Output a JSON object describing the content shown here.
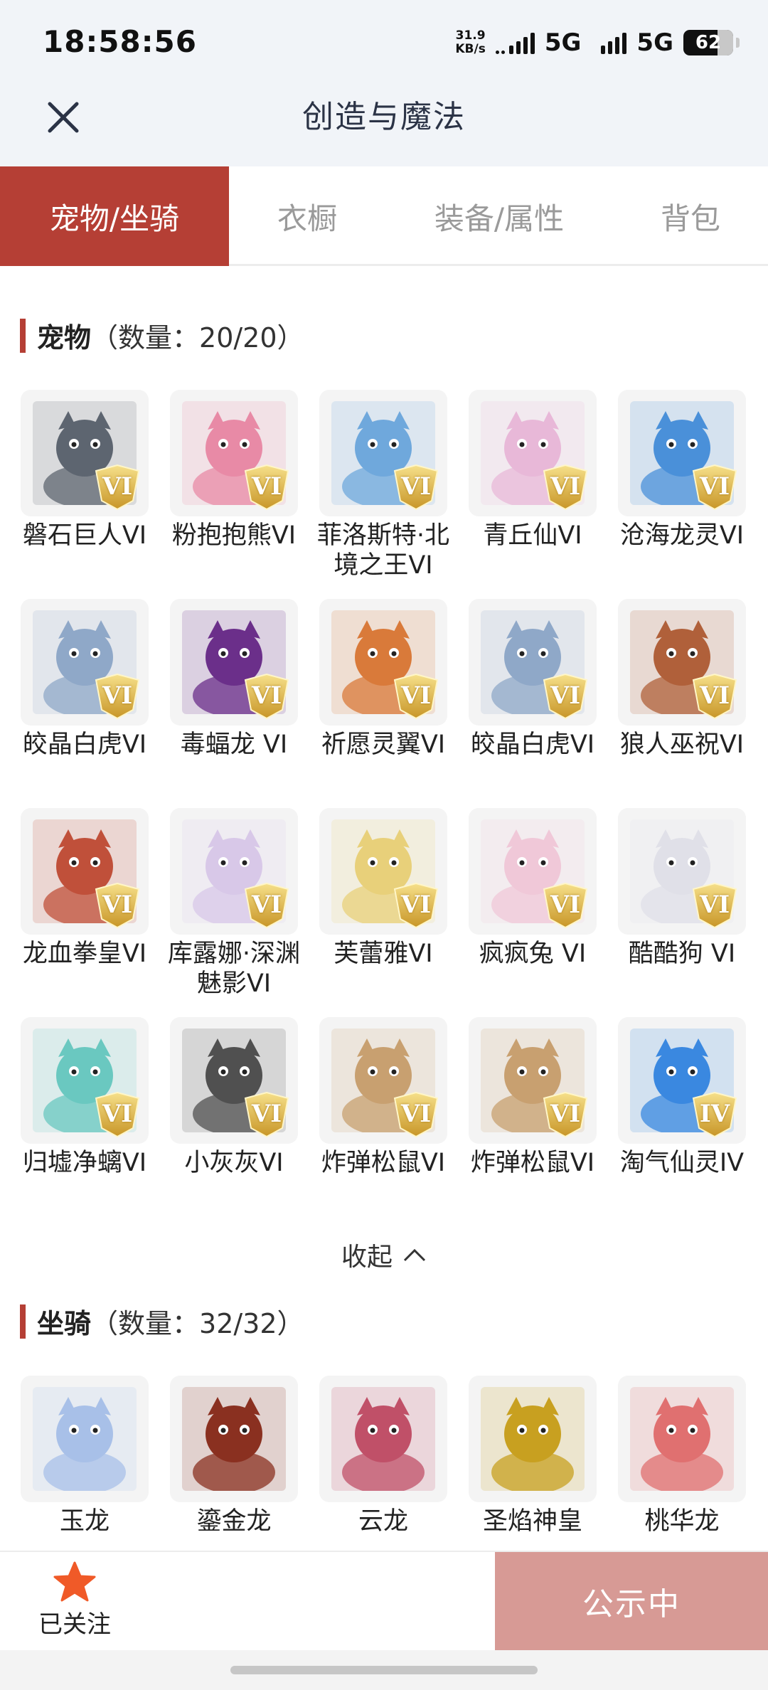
{
  "status_bar": {
    "time": "18:58:56",
    "net_speed_value": "31.9",
    "net_speed_unit": "KB/s",
    "net1": "5G",
    "net2": "5G",
    "battery": "62"
  },
  "header": {
    "title": "创造与魔法",
    "close_icon": "close-icon"
  },
  "tabs": [
    {
      "label": "宠物/坐骑",
      "active": true
    },
    {
      "label": "衣橱",
      "active": false
    },
    {
      "label": "装备/属性",
      "active": false
    },
    {
      "label": "背包",
      "active": false
    }
  ],
  "pets_section": {
    "name": "宠物",
    "count": "（数量：20/20）",
    "items": [
      {
        "name": "磐石巨人VI",
        "badge": "VI",
        "color": "#5d6570"
      },
      {
        "name": "粉抱抱熊VI",
        "badge": "VI",
        "color": "#e88aa6"
      },
      {
        "name": "菲洛斯特·北境之王VI",
        "badge": "VI",
        "color": "#6fa8dc"
      },
      {
        "name": "青丘仙VI",
        "badge": "VI",
        "color": "#e8b8d8"
      },
      {
        "name": "沧海龙灵VI",
        "badge": "VI",
        "color": "#4a90d9"
      },
      {
        "name": "皎晶白虎VI",
        "badge": "VI",
        "color": "#8fa8c8"
      },
      {
        "name": "毒蝠龙 VI",
        "badge": "VI",
        "color": "#6b2f8a"
      },
      {
        "name": "祈愿灵翼VI",
        "badge": "VI",
        "color": "#d97a3a"
      },
      {
        "name": "皎晶白虎VI",
        "badge": "VI",
        "color": "#8fa8c8"
      },
      {
        "name": "狼人巫祝VI",
        "badge": "VI",
        "color": "#b0603a"
      },
      {
        "name": "龙血拳皇VI",
        "badge": "VI",
        "color": "#c0503a"
      },
      {
        "name": "库露娜·深渊魅影VI",
        "badge": "VI",
        "color": "#d8c8e8"
      },
      {
        "name": "芙蕾雅VI",
        "badge": "VI",
        "color": "#e8d07a"
      },
      {
        "name": "疯疯兔 VI",
        "badge": "VI",
        "color": "#f0c8d8"
      },
      {
        "name": "酷酷狗 VI",
        "badge": "VI",
        "color": "#e0e0e8"
      },
      {
        "name": "归墟净螭VI",
        "badge": "VI",
        "color": "#6ac8c0"
      },
      {
        "name": "小灰灰VI",
        "badge": "VI",
        "color": "#505050"
      },
      {
        "name": "炸弹松鼠VI",
        "badge": "VI",
        "color": "#c8a070"
      },
      {
        "name": "炸弹松鼠VI",
        "badge": "VI",
        "color": "#c8a070"
      },
      {
        "name": "淘气仙灵IV",
        "badge": "IV",
        "color": "#3a88e0"
      }
    ]
  },
  "collapse_label": "收起",
  "mounts_section": {
    "name": "坐骑",
    "count": "（数量：32/32）",
    "items": [
      {
        "name": "玉龙",
        "color": "#a8c0e8"
      },
      {
        "name": "鎏金龙",
        "color": "#8a3020"
      },
      {
        "name": "云龙",
        "color": "#c05068"
      },
      {
        "name": "圣焰神皇",
        "color": "#c8a020"
      },
      {
        "name": "桃华龙",
        "color": "#e07070"
      }
    ]
  },
  "bottom_bar": {
    "follow_label": "已关注",
    "follow_icon": "star-icon",
    "announce_label": "公示中",
    "star_color": "#f05a28"
  }
}
